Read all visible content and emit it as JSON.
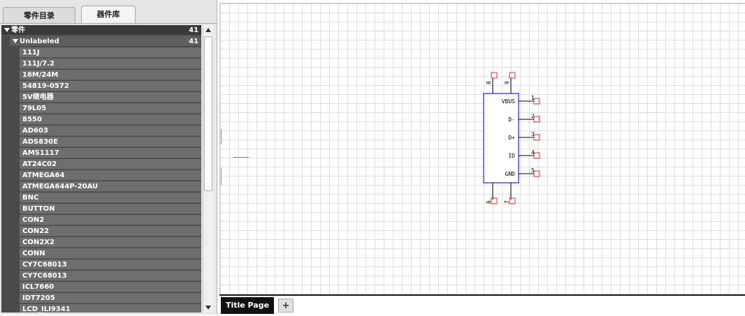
{
  "left_panel": {
    "tabs": [
      {
        "label": "零件目录"
      },
      {
        "label": "器件库"
      }
    ],
    "tree": {
      "root": {
        "label": "零件",
        "count": "41"
      },
      "group": {
        "label": "Unlabeled",
        "count": "41"
      },
      "items": [
        "111J",
        "111J/7.2",
        "16M/24M",
        "54819-0572",
        "5V继电器",
        "79L05",
        "8550",
        "AD603",
        "ADS830E",
        "AMS1117",
        "AT24C02",
        "ATMEGA64",
        "ATMEGA644P-20AU",
        "BNC",
        "BUTTON",
        "CON2",
        "CON22",
        "CON2X2",
        "CONN",
        "CY7C68013",
        "CY7C68013",
        "ICL7660",
        "IDT7205",
        "LCD_ILI9341"
      ]
    }
  },
  "component": {
    "pins_right": [
      {
        "name": "VBUS",
        "number": "1"
      },
      {
        "name": "D-",
        "number": "2"
      },
      {
        "name": "D+",
        "number": "3"
      },
      {
        "name": "ID",
        "number": "4"
      },
      {
        "name": "GND",
        "number": "5"
      }
    ],
    "pins_top": [
      "8",
      "9"
    ],
    "pins_bottom": [
      "6",
      "7"
    ],
    "colors": {
      "body": "#1a1aff",
      "pin_box": "#e03030"
    }
  },
  "page_tabs": {
    "active": "Title Page",
    "add_label": "+"
  }
}
